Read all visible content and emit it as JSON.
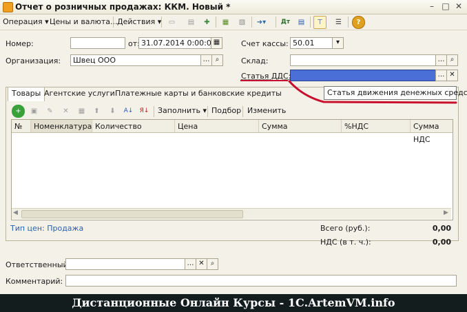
{
  "window": {
    "title": "Отчет о розничных продажах: ККМ. Новый *",
    "minimize": "–",
    "maximize": "□",
    "close": "✕"
  },
  "menubar": {
    "operation": "Операция ▾",
    "prices": "Цены и валюта...",
    "actions": "Действия ▾"
  },
  "form": {
    "number_label": "Номер:",
    "number_value": "",
    "date_label": "от:",
    "date_value": "31.07.2014  0:00:00",
    "account_label": "Счет кассы:",
    "account_value": "50.01",
    "org_label": "Организация:",
    "org_value": "Швец ООО",
    "warehouse_label": "Склад:",
    "warehouse_value": "",
    "dds_label": "Статья ДДС:",
    "dds_value": ""
  },
  "tooltip": "Статья движения денежных средств",
  "tabs": [
    {
      "label": "Товары"
    },
    {
      "label": "Агентские услуги"
    },
    {
      "label": "Платежные карты и банковские кредиты"
    }
  ],
  "grid_toolbar": {
    "fill": "Заполнить ▾",
    "select": "Подбор",
    "change": "Изменить"
  },
  "grid": {
    "columns": [
      "№",
      "Номенклатура",
      "Количество",
      "Цена",
      "Сумма",
      "%НДС",
      "Сумма НДС"
    ]
  },
  "summary": {
    "price_type": "Тип цен: Продажа",
    "total_label": "Всего (руб.):",
    "total_value": "0,00",
    "vat_label": "НДС (в т. ч.):",
    "vat_value": "0,00"
  },
  "bottom": {
    "responsible_label": "Ответственный:",
    "responsible_value": "",
    "comment_label": "Комментарий:",
    "comment_value": ""
  },
  "footer": "Дистанционные Онлайн Курсы - 1С.ArtemVM.info",
  "colors": {
    "dds_highlight": "#4a6fd6",
    "annotation": "#c8102e"
  }
}
